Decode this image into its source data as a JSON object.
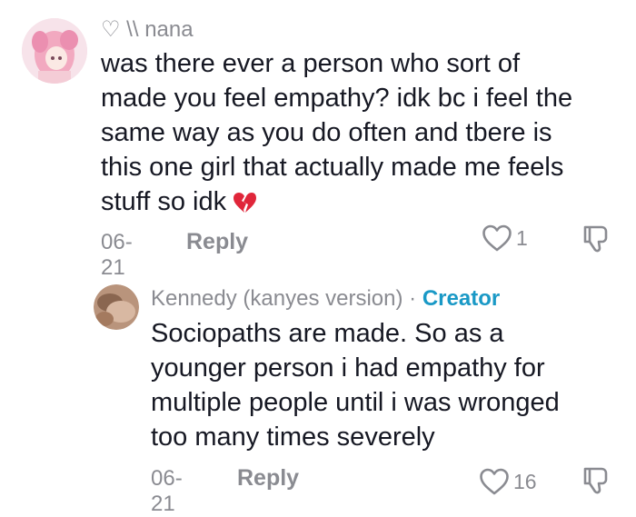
{
  "comment": {
    "username": "♡ \\\\ nana",
    "lines": [
      "was there ever a person who sort of",
      "made you feel empathy? idk bc i feel the",
      "same way as you do often and tbere is",
      "this one girl that actually made me feels",
      "stuff so idk"
    ],
    "emoji": "broken-heart",
    "date": "06-21",
    "reply_label": "Reply",
    "like_count": "1"
  },
  "reply": {
    "username": "Kennedy (kanyes version)",
    "separator": "·",
    "badge": "Creator",
    "lines": [
      "Sociopaths are made. So as a",
      "younger person i had empathy for",
      "multiple people until i was wronged",
      "too many times severely"
    ],
    "date": "06-21",
    "reply_label": "Reply",
    "like_count": "16"
  },
  "colors": {
    "text": "#161823",
    "muted": "#8a8b91",
    "creator": "#1a99c6",
    "emoji_red": "#e0263a"
  },
  "icons": [
    "heart-outline-icon",
    "dislike-icon",
    "broken-heart-emoji"
  ]
}
